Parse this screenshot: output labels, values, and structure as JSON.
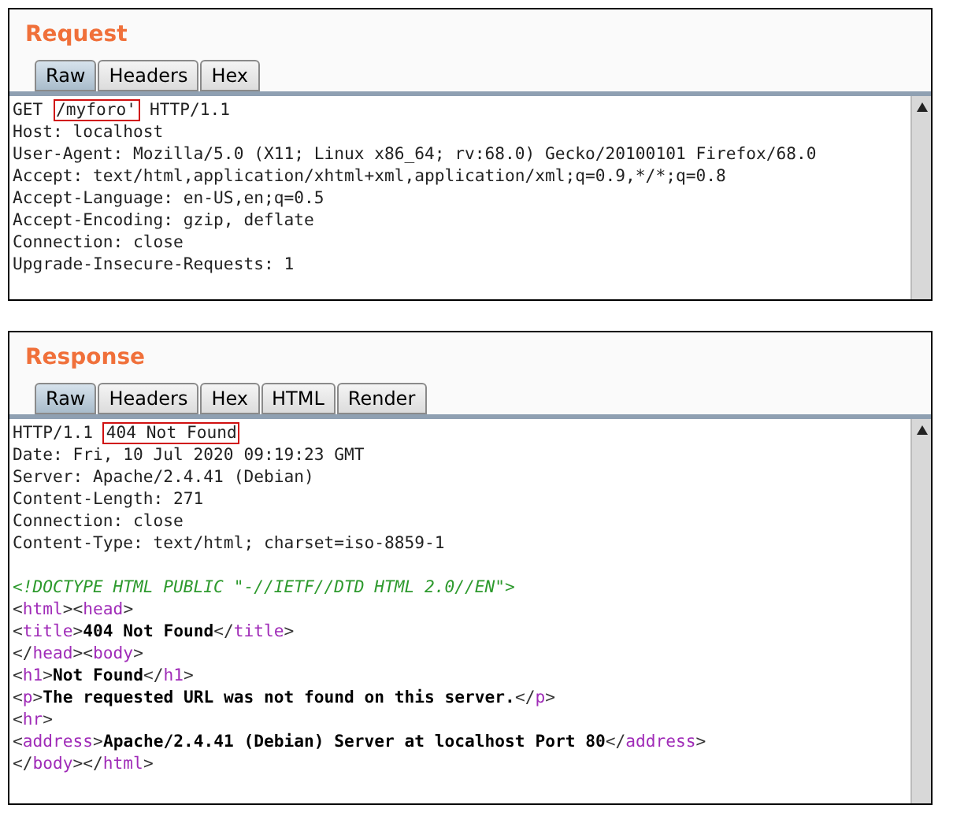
{
  "panels": [
    {
      "title": "Request",
      "tabs": [
        {
          "label": "Raw",
          "selected": true
        },
        {
          "label": "Headers",
          "selected": false
        },
        {
          "label": "Hex",
          "selected": false
        }
      ],
      "first_line": [
        {
          "text": "GET",
          "boxed": false
        },
        {
          "text": "/myforo'",
          "boxed": true
        },
        {
          "text": "HTTP/1.1",
          "boxed": false
        }
      ],
      "headers": [
        "Host: localhost",
        "User-Agent: Mozilla/5.0 (X11; Linux x86_64; rv:68.0) Gecko/20100101 Firefox/68.0",
        "Accept: text/html,application/xhtml+xml,application/xml;q=0.9,*/*;q=0.8",
        "Accept-Language: en-US,en;q=0.5",
        "Accept-Encoding: gzip, deflate",
        "Connection: close",
        "Upgrade-Insecure-Requests: 1"
      ]
    },
    {
      "title": "Response",
      "tabs": [
        {
          "label": "Raw",
          "selected": true
        },
        {
          "label": "Headers",
          "selected": false
        },
        {
          "label": "Hex",
          "selected": false
        },
        {
          "label": "HTML",
          "selected": false
        },
        {
          "label": "Render",
          "selected": false
        }
      ],
      "first_line": [
        {
          "text": "HTTP/1.1",
          "boxed": false
        },
        {
          "text": "404 Not Found",
          "boxed": true
        }
      ],
      "headers": [
        "Date: Fri, 10 Jul 2020 09:19:23 GMT",
        "Server: Apache/2.4.41 (Debian)",
        "Content-Length: 271",
        "Connection: close",
        "Content-Type: text/html; charset=iso-8859-1"
      ],
      "body": [
        [
          {
            "kind": "doctype",
            "text": "<!DOCTYPE HTML PUBLIC \"-//IETF//DTD HTML 2.0//EN\">"
          }
        ],
        [
          {
            "kind": "punct",
            "text": "<"
          },
          {
            "kind": "tag",
            "text": "html"
          },
          {
            "kind": "punct",
            "text": "><"
          },
          {
            "kind": "tag",
            "text": "head"
          },
          {
            "kind": "punct",
            "text": ">"
          }
        ],
        [
          {
            "kind": "punct",
            "text": "<"
          },
          {
            "kind": "tag",
            "text": "title"
          },
          {
            "kind": "punct",
            "text": ">"
          },
          {
            "kind": "text",
            "text": "404 Not Found"
          },
          {
            "kind": "punct",
            "text": "</"
          },
          {
            "kind": "tag",
            "text": "title"
          },
          {
            "kind": "punct",
            "text": ">"
          }
        ],
        [
          {
            "kind": "punct",
            "text": "</"
          },
          {
            "kind": "tag",
            "text": "head"
          },
          {
            "kind": "punct",
            "text": "><"
          },
          {
            "kind": "tag",
            "text": "body"
          },
          {
            "kind": "punct",
            "text": ">"
          }
        ],
        [
          {
            "kind": "punct",
            "text": "<"
          },
          {
            "kind": "tag",
            "text": "h1"
          },
          {
            "kind": "punct",
            "text": ">"
          },
          {
            "kind": "text",
            "text": "Not Found"
          },
          {
            "kind": "punct",
            "text": "</"
          },
          {
            "kind": "tag",
            "text": "h1"
          },
          {
            "kind": "punct",
            "text": ">"
          }
        ],
        [
          {
            "kind": "punct",
            "text": "<"
          },
          {
            "kind": "tag",
            "text": "p"
          },
          {
            "kind": "punct",
            "text": ">"
          },
          {
            "kind": "text",
            "text": "The requested URL was not found on this server."
          },
          {
            "kind": "punct",
            "text": "</"
          },
          {
            "kind": "tag",
            "text": "p"
          },
          {
            "kind": "punct",
            "text": ">"
          }
        ],
        [
          {
            "kind": "punct",
            "text": "<"
          },
          {
            "kind": "tag",
            "text": "hr"
          },
          {
            "kind": "punct",
            "text": ">"
          }
        ],
        [
          {
            "kind": "punct",
            "text": "<"
          },
          {
            "kind": "tag",
            "text": "address"
          },
          {
            "kind": "punct",
            "text": ">"
          },
          {
            "kind": "text",
            "text": "Apache/2.4.41 (Debian) Server at localhost Port 80"
          },
          {
            "kind": "punct",
            "text": "</"
          },
          {
            "kind": "tag",
            "text": "address"
          },
          {
            "kind": "punct",
            "text": ">"
          }
        ],
        [
          {
            "kind": "punct",
            "text": "</"
          },
          {
            "kind": "tag",
            "text": "body"
          },
          {
            "kind": "punct",
            "text": "></"
          },
          {
            "kind": "tag",
            "text": "html"
          },
          {
            "kind": "punct",
            "text": ">"
          }
        ]
      ]
    }
  ]
}
